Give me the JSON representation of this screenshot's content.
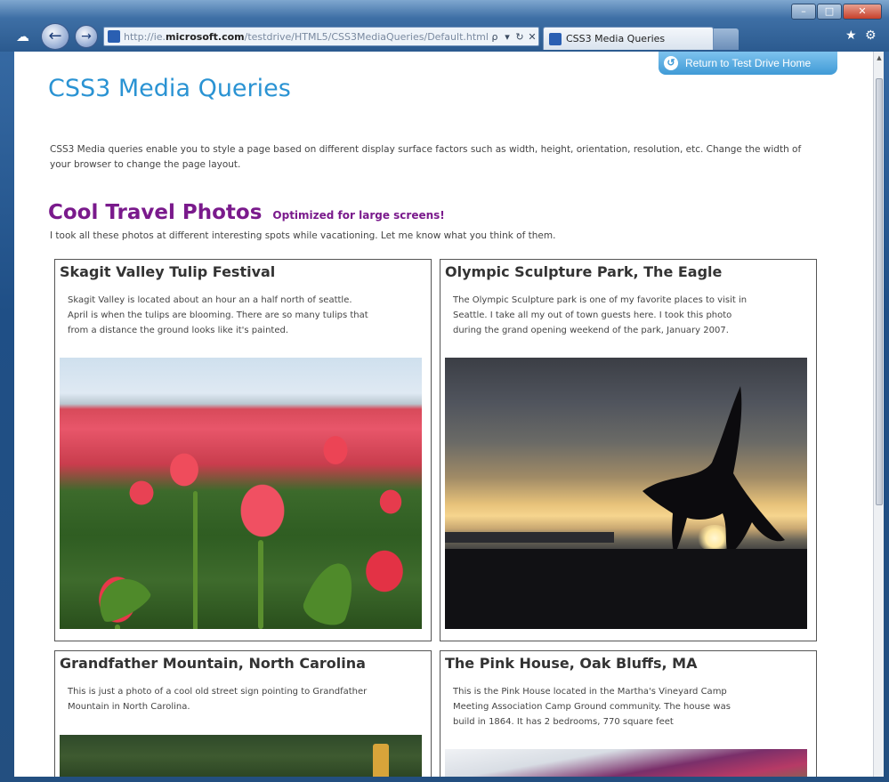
{
  "browser": {
    "url_prefix": "http://ie.",
    "url_domain": "microsoft.com",
    "url_path": "/testdrive/HTML5/CSS3MediaQueries/Default.html",
    "tab_title": "CSS3 Media Queries",
    "address_actions": [
      "ρ",
      "▾",
      "↻",
      "✕"
    ]
  },
  "page": {
    "return_button": "Return to Test Drive Home",
    "title": "CSS3 Media Queries",
    "intro": "CSS3 Media queries enable you to style a page based on different display surface factors such as width, height, orientation, resolution, etc. Change the width of your browser to change the page layout.",
    "section_title": "Cool Travel Photos",
    "section_subtitle": "Optimized for large screens!",
    "section_desc": "I took all these photos at different interesting spots while vacationing. Let me know what you think of them."
  },
  "cards": [
    {
      "title": "Skagit Valley Tulip Festival",
      "desc_lines": [
        "Skagit Valley is located about an hour an a half north of seattle.",
        "April is when the tulips are blooming. There are so many tulips that",
        "from a distance the ground looks like it's painted."
      ]
    },
    {
      "title": "Olympic Sculpture Park, The Eagle",
      "desc_lines": [
        "The Olympic Sculpture park is one of my favorite places to visit in",
        "Seattle. I take all my out of town guests here. I took this photo",
        "during the grand opening weekend of the park, January 2007."
      ]
    },
    {
      "title": "Grandfather Mountain, North Carolina",
      "desc_lines": [
        "This is just a photo of a cool old street sign pointing to Grandfather",
        "Mountain in North Carolina."
      ]
    },
    {
      "title": "The Pink House, Oak Bluffs, MA",
      "desc_lines": [
        "This is the Pink House located in the Martha's Vineyard Camp",
        "Meeting Association Camp Ground community. The house was",
        "build in 1864. It has 2 bedrooms, 770 square feet"
      ]
    }
  ]
}
